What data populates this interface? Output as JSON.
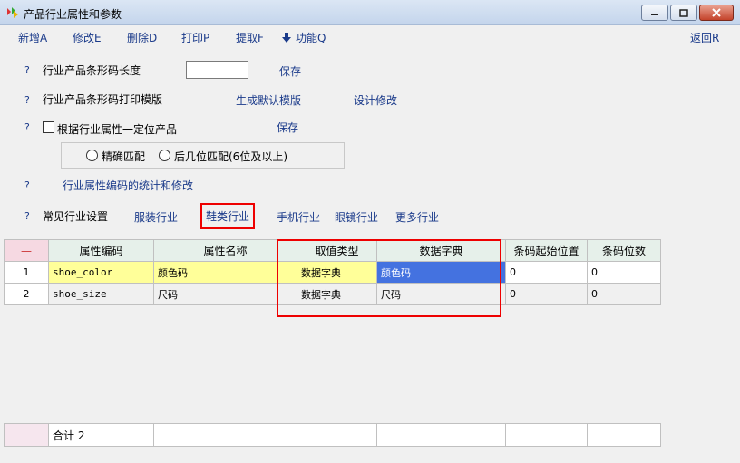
{
  "window": {
    "title": "产品行业属性和参数"
  },
  "menu": {
    "new": "新增",
    "new_key": "A",
    "edit": "修改",
    "edit_key": "E",
    "delete": "删除",
    "delete_key": "D",
    "print": "打印",
    "print_key": "P",
    "extract": "提取",
    "extract_key": "F",
    "function": "功能",
    "function_key": "Q",
    "back": "返回",
    "back_key": "R"
  },
  "help_mark": "?",
  "settings": {
    "barcode_length_label": "行业产品条形码长度",
    "barcode_length_value": "",
    "save1": "保存",
    "print_template_label": "行业产品条形码打印模版",
    "gen_default": "生成默认模版",
    "design_edit": "设计修改",
    "locate_by_attr_label": "根据行业属性一定位产品",
    "save2": "保存",
    "exact_match": "精确匹配",
    "suffix_match": "后几位匹配(6位及以上)",
    "attr_stats": "行业属性编码的统计和修改",
    "common_label": "常见行业设置",
    "industries": [
      "服装行业",
      "鞋类行业",
      "手机行业",
      "眼镜行业",
      "更多行业"
    ]
  },
  "grid": {
    "corner": "—",
    "headers": [
      "属性编码",
      "属性名称",
      "取值类型",
      "数据字典",
      "条码起始位置",
      "条码位数"
    ],
    "rows": [
      {
        "n": "1",
        "code": "shoe_color",
        "name": "颜色码",
        "type": "数据字典",
        "dict": "颜色码",
        "start": "0",
        "digits": "0"
      },
      {
        "n": "2",
        "code": "shoe_size",
        "name": "尺码",
        "type": "数据字典",
        "dict": "尺码",
        "start": "0",
        "digits": "0"
      }
    ],
    "total_label": "合计 2"
  },
  "colors": {
    "link": "#1a3a8a",
    "highlight_row": "#ffff99",
    "selected_cell": "#4472e0",
    "annotation": "#ee0000"
  }
}
